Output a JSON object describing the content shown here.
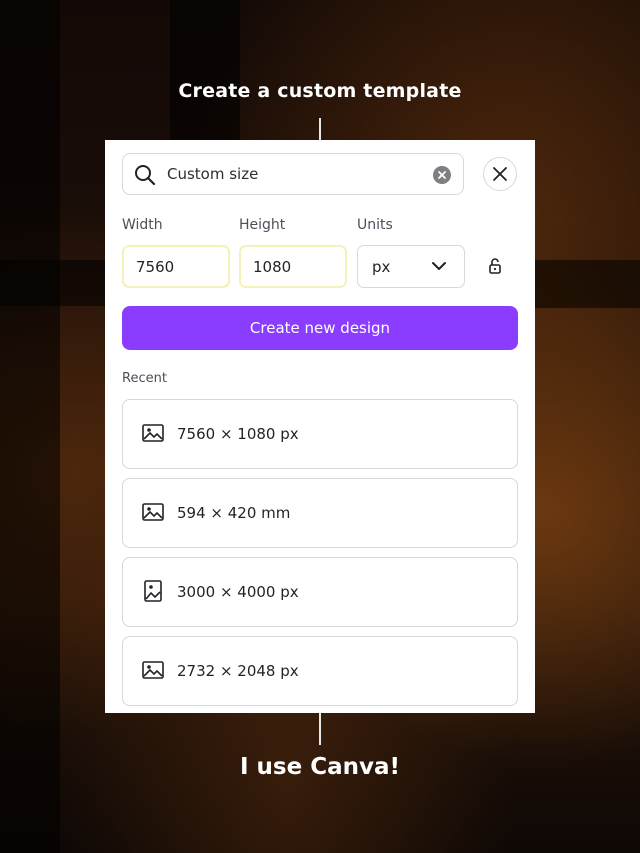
{
  "headline_top": "Create a custom template",
  "headline_bottom": "I use Canva!",
  "search": {
    "value": "Custom size"
  },
  "fields": {
    "width_label": "Width",
    "height_label": "Height",
    "units_label": "Units",
    "width_value": "7560",
    "height_value": "1080",
    "units_value": "px"
  },
  "create_button_label": "Create new design",
  "recent_label": "Recent",
  "recent_items": [
    {
      "label": "7560 × 1080 px",
      "icon": "landscape-image-icon"
    },
    {
      "label": "594 × 420 mm",
      "icon": "landscape-image-icon"
    },
    {
      "label": "3000 × 4000 px",
      "icon": "portrait-image-icon"
    },
    {
      "label": "2732 × 2048 px",
      "icon": "landscape-image-icon"
    }
  ],
  "colors": {
    "accent": "#8b3dff",
    "field_highlight": "#f4f2b8"
  }
}
